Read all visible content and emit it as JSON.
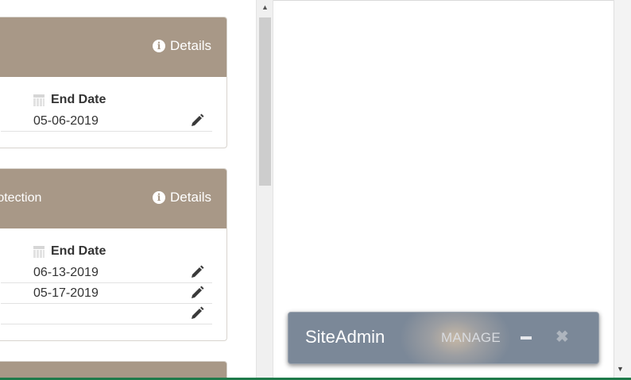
{
  "cards": [
    {
      "title": "",
      "details_label": "Details",
      "end_date_label": "End Date",
      "rows": [
        "05-06-2019"
      ]
    },
    {
      "title": "rotection",
      "details_label": "Details",
      "end_date_label": "End Date",
      "rows": [
        "06-13-2019",
        "05-17-2019",
        ""
      ]
    }
  ],
  "siteadmin": {
    "title": "SiteAdmin",
    "manage_label": "MANAGE",
    "minimize_icon": "minus-icon",
    "close_icon": "close-icon"
  },
  "colors": {
    "card_header": "#a89887",
    "toolbar": "#7b8898",
    "window_border": "#1f7a4a"
  }
}
